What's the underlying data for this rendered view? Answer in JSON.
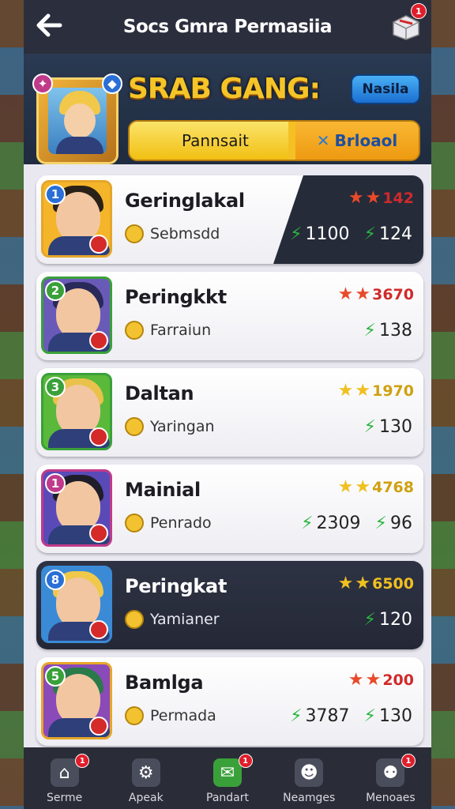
{
  "topbar": {
    "title": "Socs Gmra Permasiia",
    "gift_badge": "1"
  },
  "header": {
    "title": "SRAB GANG:",
    "side_button": "Nasila",
    "progress": {
      "label": "Pannsait",
      "fraction": 0.55,
      "side_label": "Brloaol"
    }
  },
  "rows": [
    {
      "rank": "1",
      "name": "Geringlakal",
      "sub_label": "Sebmsdd",
      "stars_score": "142",
      "stat1": "1100",
      "stat2": "124",
      "rank_color": "#2a6fd6",
      "frame": "#e6a62a",
      "bg": "#f5b52a",
      "hair": "#2a2218",
      "star_color": "#e84a2a",
      "score_color": "#d02a2a",
      "dark_tail": true,
      "dark": false
    },
    {
      "rank": "2",
      "name": "Peringkkt",
      "sub_label": "Farraiun",
      "stars_score": "3670",
      "stat1": "",
      "stat2": "138",
      "rank_color": "#3aa03a",
      "frame": "#3aa03a",
      "bg": "#6a5ab8",
      "hair": "#2a2a5a",
      "star_color": "#e84a2a",
      "score_color": "#d02a2a",
      "dark_tail": false,
      "dark": false
    },
    {
      "rank": "3",
      "name": "Daltan",
      "sub_label": "Yaringan",
      "stars_score": "1970",
      "stat1": "",
      "stat2": "130",
      "rank_color": "#3aa03a",
      "frame": "#3aa03a",
      "bg": "#5ab83a",
      "hair": "#e8c24a",
      "star_color": "#f0c020",
      "score_color": "#d0a010",
      "dark_tail": false,
      "dark": false
    },
    {
      "rank": "1",
      "name": "Mainial",
      "sub_label": "Penrado",
      "stars_score": "4768",
      "stat1": "2309",
      "stat2": "96",
      "rank_color": "#c03a8a",
      "frame": "#c03a8a",
      "bg": "#5a4ab8",
      "hair": "#1e1e2a",
      "star_color": "#f0c020",
      "score_color": "#d0a010",
      "dark_tail": false,
      "dark": false
    },
    {
      "rank": "8",
      "name": "Peringkat",
      "sub_label": "Yamianer",
      "stars_score": "6500",
      "stat1": "",
      "stat2": "120",
      "rank_color": "#2a6fd6",
      "frame": "#3a8ad6",
      "bg": "#3a8ad6",
      "hair": "#f0c84a",
      "star_color": "#f0c020",
      "score_color": "#f0c020",
      "dark_tail": false,
      "dark": true
    },
    {
      "rank": "5",
      "name": "Bamlga",
      "sub_label": "Permada",
      "stars_score": "200",
      "stat1": "3787",
      "stat2": "130",
      "rank_color": "#3aa03a",
      "frame": "#e6a62a",
      "bg": "#8a4ab8",
      "hair": "#2a7a4a",
      "star_color": "#e84a2a",
      "score_color": "#d02a2a",
      "dark_tail": false,
      "dark": false
    }
  ],
  "nav": [
    {
      "label": "Serme",
      "icon": "home-icon",
      "badge": "1"
    },
    {
      "label": "Apeak",
      "icon": "search-icon",
      "badge": ""
    },
    {
      "label": "Pandart",
      "icon": "chat-icon",
      "badge": "1"
    },
    {
      "label": "Neamges",
      "icon": "friends-icon",
      "badge": ""
    },
    {
      "label": "Menoaes",
      "icon": "profile-icon",
      "badge": "1"
    }
  ]
}
